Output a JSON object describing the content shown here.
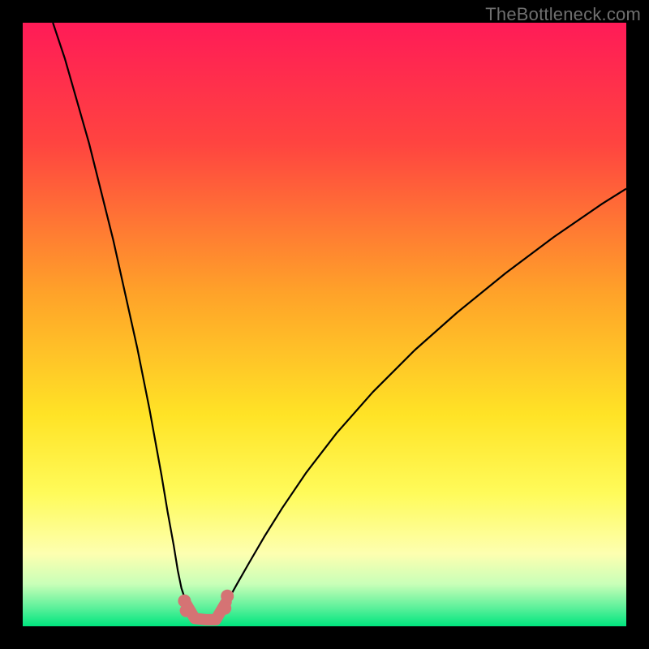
{
  "watermark": "TheBottleneck.com",
  "chart_data": {
    "type": "line",
    "title": "",
    "xlabel": "",
    "ylabel": "",
    "xlim": [
      0,
      100
    ],
    "ylim": [
      0,
      100
    ],
    "grid": false,
    "legend": false,
    "annotations": [],
    "background_gradient": {
      "stops": [
        {
          "pos": 0.0,
          "color": "#ff1b57"
        },
        {
          "pos": 0.2,
          "color": "#ff4440"
        },
        {
          "pos": 0.45,
          "color": "#ffa329"
        },
        {
          "pos": 0.65,
          "color": "#ffe326"
        },
        {
          "pos": 0.78,
          "color": "#fffb5a"
        },
        {
          "pos": 0.88,
          "color": "#fdffb0"
        },
        {
          "pos": 0.93,
          "color": "#c9ffb8"
        },
        {
          "pos": 0.97,
          "color": "#5af09a"
        },
        {
          "pos": 1.0,
          "color": "#00e57e"
        }
      ]
    },
    "series": [
      {
        "name": "curve-left",
        "color": "#000000",
        "width": 2.2,
        "x": [
          5,
          7,
          9,
          11,
          13,
          15,
          17,
          19,
          21,
          23,
          24,
          25,
          25.7,
          26.3,
          27,
          27.5,
          28,
          28.5
        ],
        "y": [
          100,
          94,
          87,
          80,
          72,
          64,
          55,
          46,
          36,
          25,
          19,
          13.5,
          9.2,
          6.3,
          4.2,
          2.8,
          1.8,
          1.2
        ]
      },
      {
        "name": "curve-right",
        "color": "#000000",
        "width": 2.2,
        "x": [
          32.2,
          33,
          34,
          35.5,
          37.5,
          40,
          43,
          47,
          52,
          58,
          65,
          72,
          80,
          88,
          96,
          100
        ],
        "y": [
          1.2,
          2.4,
          4.3,
          7.0,
          10.5,
          14.8,
          19.6,
          25.5,
          32.0,
          38.8,
          45.8,
          52.0,
          58.5,
          64.5,
          70.0,
          72.5
        ]
      },
      {
        "name": "floor-segment",
        "color": "#d57374",
        "width": 14,
        "linecap": "round",
        "x": [
          26.8,
          28.5,
          30.3,
          32.0,
          33.7
        ],
        "y": [
          4.2,
          1.3,
          1.1,
          1.1,
          4.0
        ]
      }
    ],
    "floor_dots": {
      "color": "#d57374",
      "radius": 8,
      "points": [
        {
          "x": 26.8,
          "y": 4.2
        },
        {
          "x": 27.1,
          "y": 2.6
        },
        {
          "x": 33.5,
          "y": 3.0
        },
        {
          "x": 33.9,
          "y": 5.0
        }
      ]
    }
  }
}
